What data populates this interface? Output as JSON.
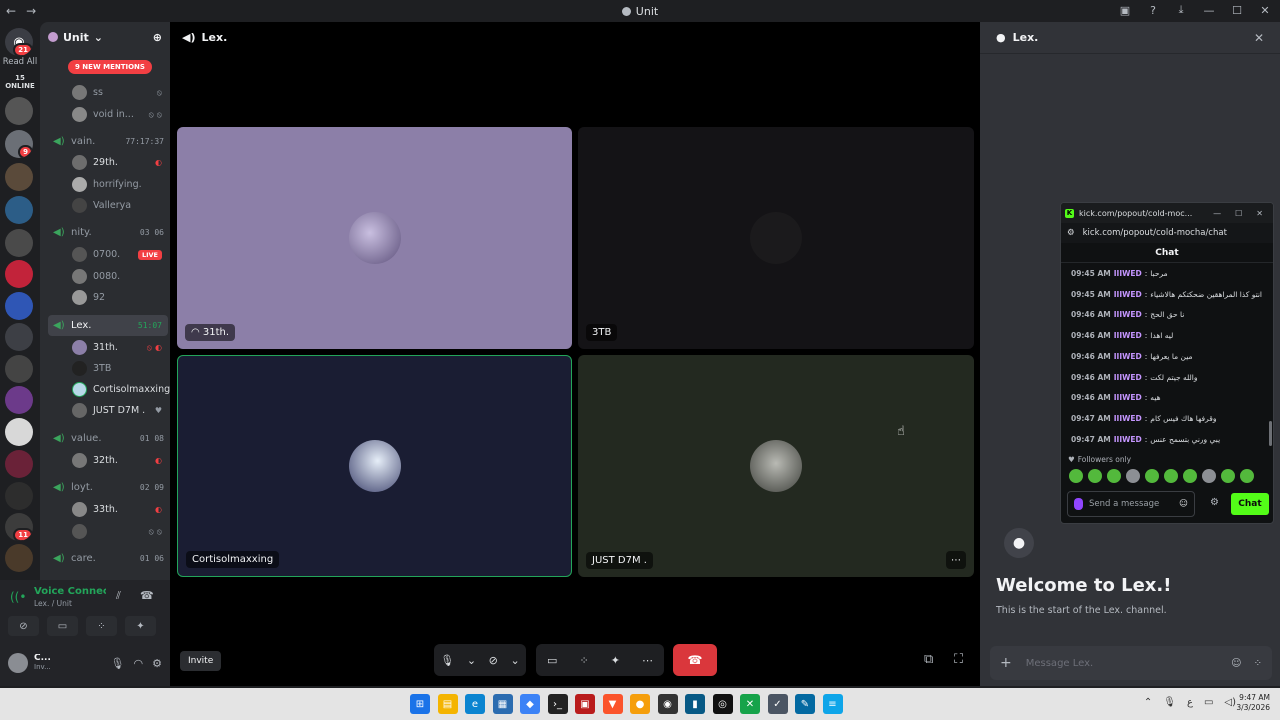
{
  "window": {
    "title": "Unit"
  },
  "rail": {
    "dm_badge": "21",
    "read_all": "Read All",
    "online": "15 ONLINE",
    "badges": [
      "9",
      "11"
    ]
  },
  "server": {
    "name": "Unit",
    "mentions": "9 NEW MENTIONS"
  },
  "channels": {
    "top_users": [
      "ss",
      "void in..."
    ],
    "vain": {
      "name": "vain.",
      "time": "77:17:37",
      "users": [
        "29th.",
        "horrifying.",
        "Vallerya"
      ]
    },
    "nity": {
      "name": "nity.",
      "c1": "03",
      "c2": "06",
      "users": [
        "0700.",
        "0080.",
        "92"
      ],
      "live": "LIVE"
    },
    "lex": {
      "name": "Lex.",
      "time": "51:07",
      "users": [
        "31th.",
        "3TB",
        "Cortisolmaxxing",
        "JUST D7M ."
      ]
    },
    "value": {
      "name": "value.",
      "c1": "01",
      "c2": "08",
      "users": [
        "32th."
      ]
    },
    "loyt": {
      "name": "loyt.",
      "c1": "02",
      "c2": "09",
      "users": [
        "33th."
      ]
    },
    "care": {
      "name": "care.",
      "c1": "01",
      "c2": "06"
    }
  },
  "voice": {
    "status": "Voice Connected",
    "sub": "Lex. / Unit"
  },
  "user": {
    "name": "C...",
    "status": "Inv..."
  },
  "stage": {
    "channel": "Lex.",
    "tiles": [
      "31th.",
      "3TB",
      "Cortisolmaxxing",
      "JUST D7M ."
    ],
    "invite": "Invite"
  },
  "text_panel": {
    "channel": "Lex.",
    "welcome_title": "Welcome to Lex.!",
    "welcome_sub": "This is the start of the Lex. channel.",
    "placeholder": "Message Lex."
  },
  "popout": {
    "title": "kick.com/popout/cold-moc...",
    "url": "kick.com/popout/cold-mocha/chat",
    "chat_header": "Chat",
    "messages": [
      {
        "time": "09:45 AM",
        "user": "IIIWED",
        "text": "مرحبا"
      },
      {
        "time": "09:45 AM",
        "user": "IIIWED",
        "text": "انتو كذا المراهقين ضحكتكم هالاشياء"
      },
      {
        "time": "09:46 AM",
        "user": "IIIWED",
        "text": "نا حق الحج"
      },
      {
        "time": "09:46 AM",
        "user": "IIIWED",
        "text": "ليه اهدا"
      },
      {
        "time": "09:46 AM",
        "user": "IIIWED",
        "text": "مين ما يعرفها"
      },
      {
        "time": "09:46 AM",
        "user": "IIIWED",
        "text": "والله جيتم لكت"
      },
      {
        "time": "09:46 AM",
        "user": "IIIWED",
        "text": "هيه"
      },
      {
        "time": "09:47 AM",
        "user": "IIIWED",
        "text": "وقرفها هاك فيس كام"
      },
      {
        "time": "09:47 AM",
        "user": "IIIWED",
        "text": "يبي ورني بتسمح عنس"
      }
    ],
    "followers_only": "Followers only",
    "input_placeholder": "Send a message",
    "send_label": "Chat"
  },
  "taskbar": {
    "time": "9:47 AM",
    "date": "3/3/2026",
    "lang": "ع"
  },
  "colors": {
    "accent_green": "#23a55a",
    "danger": "#da373c",
    "kick_green": "#53fc18",
    "tile1": "#8c7fa8",
    "tile2": "#141316",
    "tile3": "#1a1d33",
    "tile4": "#232920"
  }
}
